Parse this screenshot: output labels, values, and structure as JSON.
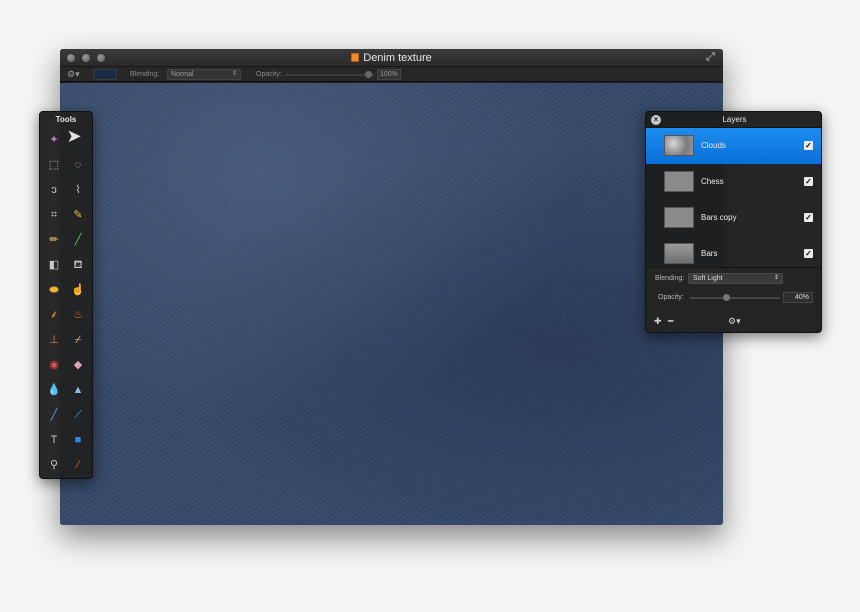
{
  "window": {
    "title": "Denim texture"
  },
  "toolbar": {
    "blending_label": "Blending:",
    "blending_value": "Normal",
    "opacity_label": "Opacity:",
    "opacity_value": "100%"
  },
  "tools": {
    "title": "Tools",
    "items": [
      "magic-wand-icon",
      "move-arrow-icon",
      "rect-select-icon",
      "ellipse-select-icon",
      "lasso-icon",
      "polygon-lasso-icon",
      "crop-icon",
      "eyedropper-icon",
      "pencil-icon",
      "brush-icon",
      "gradient-icon",
      "paint-bucket-icon",
      "sponge-icon",
      "smudge-icon",
      "burn-icon",
      "dodge-icon",
      "stamp-icon",
      "bandage-icon",
      "red-eye-icon",
      "eraser-icon",
      "blur-icon",
      "sharpen-icon",
      "pen-icon",
      "path-icon",
      "text-icon",
      "shape-icon",
      "zoom-icon",
      "color-picker-icon"
    ]
  },
  "layers": {
    "title": "Layers",
    "rows": [
      {
        "name": "Clouds",
        "active": true
      },
      {
        "name": "Chess",
        "active": false
      },
      {
        "name": "Bars copy",
        "active": false
      },
      {
        "name": "Bars",
        "active": false
      }
    ],
    "blending_label": "Blending:",
    "blending_value": "Soft Light",
    "opacity_label": "Opacity:",
    "opacity_value": "40%"
  },
  "colors": {
    "accent": "#1b8df0",
    "canvas": "#34486a"
  }
}
